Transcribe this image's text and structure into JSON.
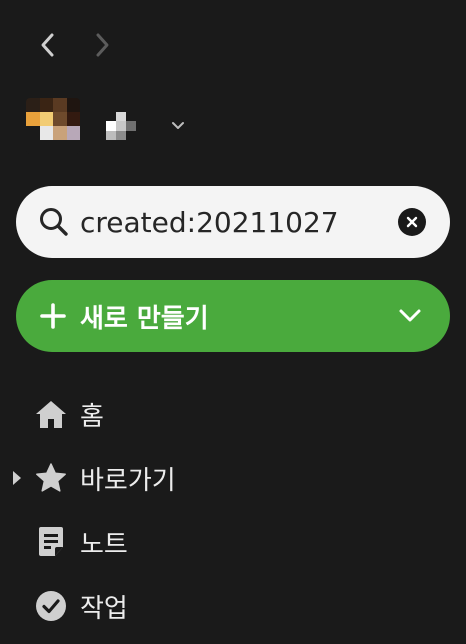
{
  "navigation": {
    "back_icon": "chevron-left-icon",
    "forward_icon": "chevron-right-icon"
  },
  "account": {
    "avatar_colors": [
      "#2b1f17",
      "#3a2414",
      "#5a3a22",
      "#1f1510",
      "#e9a13b",
      "#f2cc74",
      "#6e4a2c",
      "#331a10",
      "#1a1a1a",
      "#e8e8e8",
      "#c9a27a",
      "#b8a8b8",
      "#1a1a1a",
      "#1a1a1a",
      "#1a1a1a",
      "#1a1a1a"
    ],
    "name_colors": [
      "#1a1a1a",
      "#d8d8d8",
      "#1a1a1a",
      "#ffffff",
      "#c8c8c8",
      "#707070",
      "#bdbdbd",
      "#8c8c8c",
      "#1a1a1a"
    ],
    "chevron_icon": "chevron-down-icon"
  },
  "search": {
    "value": "created:20211027",
    "icon": "search-icon",
    "clear_icon": "clear-icon"
  },
  "new_note": {
    "label": "새로 만들기",
    "color": "#4aaa3d",
    "icon": "plus-icon",
    "dropdown_icon": "chevron-down-icon"
  },
  "sidebar": {
    "items": [
      {
        "label": "홈",
        "icon": "home-icon"
      },
      {
        "label": "바로가기",
        "icon": "star-icon",
        "expandable": true
      },
      {
        "label": "노트",
        "icon": "note-icon"
      },
      {
        "label": "작업",
        "icon": "check-circle-icon"
      }
    ]
  }
}
